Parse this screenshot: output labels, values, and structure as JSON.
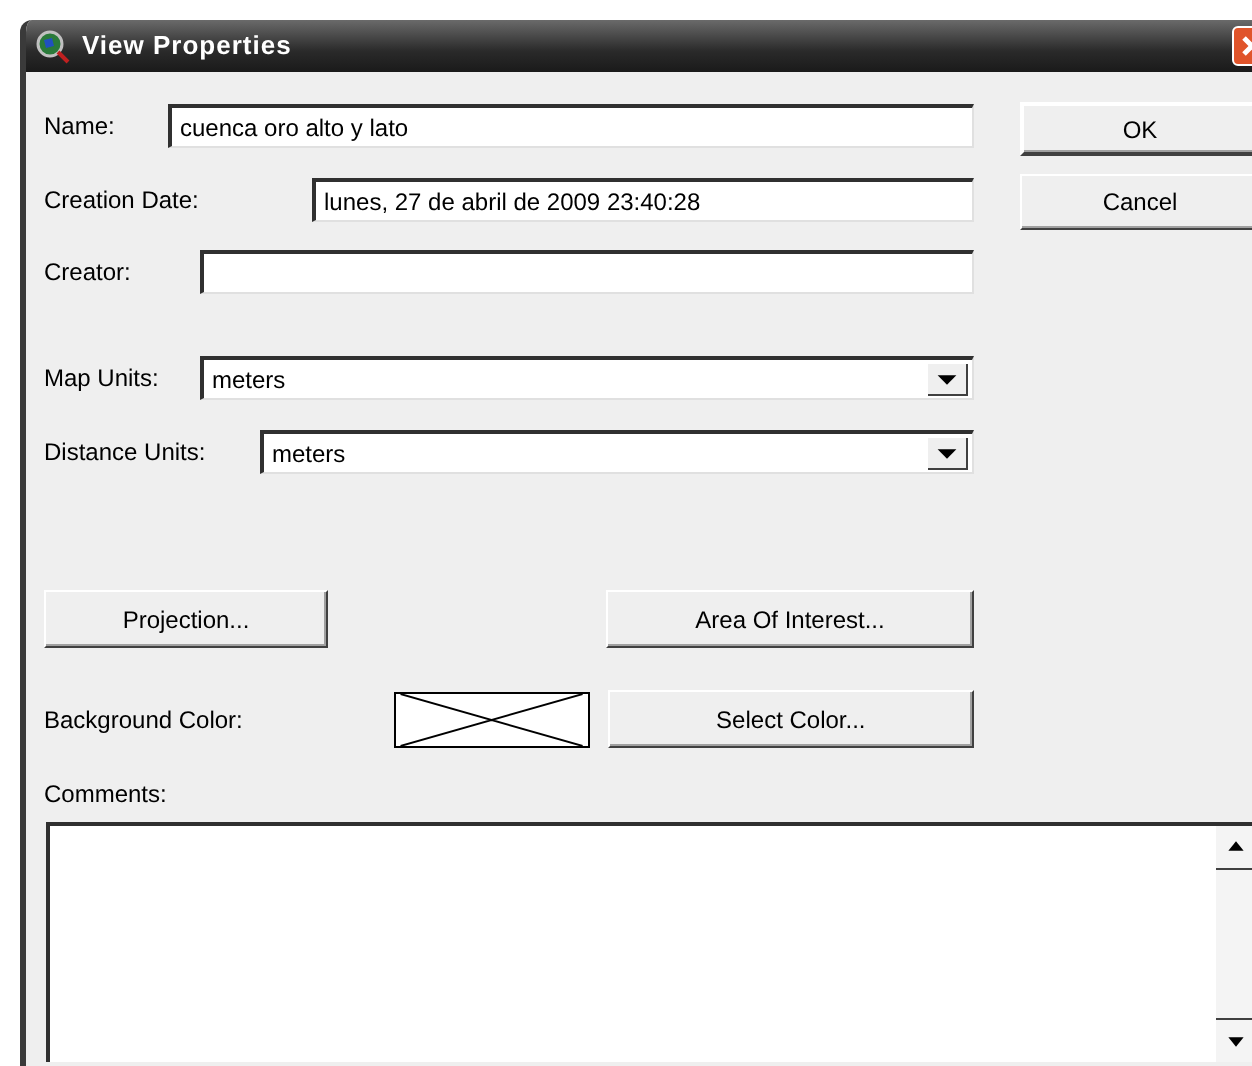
{
  "window": {
    "title": "View Properties"
  },
  "fields": [
    {
      "label": "Name:",
      "value": "cuenca oro alto y lato"
    },
    {
      "label": "Creation Date:",
      "value": "lunes, 27 de abril de 2009 23:40:28"
    },
    {
      "label": "Creator:"
    }
  ],
  "selects": [
    {
      "label": "Map Units:",
      "value": "meters"
    },
    {
      "label": "Distance Units:",
      "value": "meters"
    }
  ],
  "buttons": {
    "ok": "OK",
    "cancel": "Cancel",
    "projection": "Projection...",
    "area_of_interest": "Area Of Interest...",
    "select_color": "Select Color..."
  },
  "background_color": {
    "label": "Background Color:"
  },
  "comments": {
    "label": "Comments:"
  }
}
